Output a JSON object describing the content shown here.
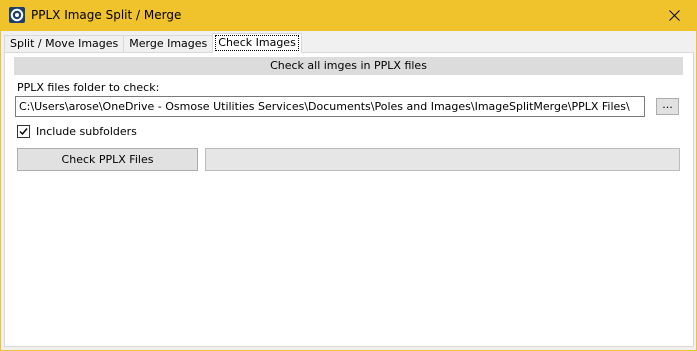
{
  "window": {
    "title": "PPLX Image Split / Merge",
    "app_icon": "pplx-app-icon",
    "close_icon": "close-icon"
  },
  "tabs": [
    {
      "label": "Split / Move Images",
      "active": false
    },
    {
      "label": "Merge Images",
      "active": false
    },
    {
      "label": "Check Images",
      "active": true
    }
  ],
  "check_images": {
    "header": "Check all imges in PPLX files",
    "folder_label": "PPLX files folder to check:",
    "folder_path": "C:\\Users\\arose\\OneDrive - Osmose Utilities Services\\Documents\\Poles and Images\\ImageSplitMerge\\PPLX Files\\",
    "browse_label": "...",
    "include_subfolders_label": "Include subfolders",
    "include_subfolders_checked": true,
    "check_button_label": "Check PPLX Files",
    "progress_value": 0
  },
  "colors": {
    "titlebar": "#f0c32c",
    "header_bar": "#dcdcdc",
    "button": "#e1e1e1"
  }
}
